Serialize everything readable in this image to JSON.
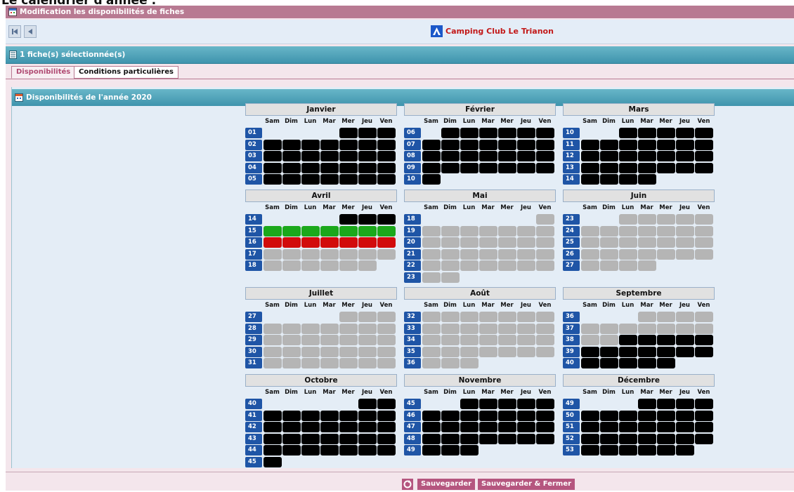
{
  "top_cut_text": "Le calendrier d'année :",
  "window": {
    "title": "Modification les disponibilités de fiches"
  },
  "toolbar": {
    "brand": "Camping Club Le Trianon"
  },
  "selection": {
    "text": "1 fiche(s) sélectionnée(s)"
  },
  "tabs": [
    {
      "label": "Disponibilités"
    },
    {
      "label": "Conditions particulières"
    }
  ],
  "panel": {
    "title": "Disponibilités de l'année 2020"
  },
  "day_names": [
    "Sam",
    "Dim",
    "Lun",
    "Mar",
    "Mer",
    "Jeu",
    "Ven"
  ],
  "legend_colors": {
    "black": "#000000",
    "grey": "#b5b5b5",
    "green": "#1ba81b",
    "red": "#d20b0b",
    "week_badge": "#1f55a6"
  },
  "months": [
    {
      "name": "Janvier",
      "weeks": [
        [
          "01",
          "....bbb"
        ],
        [
          "02",
          "bbbbbbb"
        ],
        [
          "03",
          "bbbbbbb"
        ],
        [
          "04",
          "bbbbbbb"
        ],
        [
          "05",
          "bbbbbbb"
        ]
      ]
    },
    {
      "name": "Février",
      "weeks": [
        [
          "06",
          ".bbbbbb"
        ],
        [
          "07",
          "bbbbbbb"
        ],
        [
          "08",
          "bbbbbbb"
        ],
        [
          "09",
          "bbbbbbb"
        ],
        [
          "10",
          "b......"
        ]
      ]
    },
    {
      "name": "Mars",
      "weeks": [
        [
          "10",
          "..bbbbb"
        ],
        [
          "11",
          "bbbbbbb"
        ],
        [
          "12",
          "bbbbbbb"
        ],
        [
          "13",
          "bbbbbbb"
        ],
        [
          "14",
          "bbbb..."
        ]
      ]
    },
    {
      "name": "Avril",
      "weeks": [
        [
          "14",
          "....bbb"
        ],
        [
          "15",
          "GGGGGGG"
        ],
        [
          "16",
          "RRRRRRR"
        ],
        [
          "17",
          "ggggggg"
        ],
        [
          "18",
          "gggggg."
        ]
      ]
    },
    {
      "name": "Mai",
      "weeks": [
        [
          "18",
          "......g"
        ],
        [
          "19",
          "ggggggg"
        ],
        [
          "20",
          "ggggggg"
        ],
        [
          "21",
          "ggggggg"
        ],
        [
          "22",
          "ggggggg"
        ],
        [
          "23",
          "gg....."
        ]
      ]
    },
    {
      "name": "Juin",
      "weeks": [
        [
          "23",
          "..ggggg"
        ],
        [
          "24",
          "ggggggg"
        ],
        [
          "25",
          "ggggggg"
        ],
        [
          "26",
          "ggggggg"
        ],
        [
          "27",
          "gggg..."
        ]
      ]
    },
    {
      "name": "Juillet",
      "weeks": [
        [
          "27",
          "....ggg"
        ],
        [
          "28",
          "ggggggg"
        ],
        [
          "29",
          "ggggggg"
        ],
        [
          "30",
          "ggggggg"
        ],
        [
          "31",
          "ggggggg"
        ]
      ]
    },
    {
      "name": "Août",
      "weeks": [
        [
          "32",
          "ggggggg"
        ],
        [
          "33",
          "ggggggg"
        ],
        [
          "34",
          "ggggggg"
        ],
        [
          "35",
          "ggggggg"
        ],
        [
          "36",
          "ggg...."
        ]
      ]
    },
    {
      "name": "Septembre",
      "weeks": [
        [
          "36",
          "...gggg"
        ],
        [
          "37",
          "ggggggg"
        ],
        [
          "38",
          "ggbbbbb"
        ],
        [
          "39",
          "bbbbbbb"
        ],
        [
          "40",
          "bbbbb.."
        ]
      ]
    },
    {
      "name": "Octobre",
      "weeks": [
        [
          "40",
          ".....bb"
        ],
        [
          "41",
          "bbbbbbb"
        ],
        [
          "42",
          "bbbbbbb"
        ],
        [
          "43",
          "bbbbbbb"
        ],
        [
          "44",
          "bbbbbbb"
        ],
        [
          "45",
          "b......"
        ]
      ]
    },
    {
      "name": "Novembre",
      "weeks": [
        [
          "45",
          "..bbbbb"
        ],
        [
          "46",
          "bbbbbbb"
        ],
        [
          "47",
          "bbbbbbb"
        ],
        [
          "48",
          "bbbbbbb"
        ],
        [
          "49",
          "bbb...."
        ]
      ]
    },
    {
      "name": "Décembre",
      "weeks": [
        [
          "49",
          "...bbbb"
        ],
        [
          "50",
          "bbbbbbb"
        ],
        [
          "51",
          "bbbbbbb"
        ],
        [
          "52",
          "bbbbbbb"
        ],
        [
          "53",
          "bbbbbb."
        ]
      ]
    }
  ],
  "footer": {
    "save": "Sauvegarder",
    "save_close": "Sauvegarder & Fermer"
  }
}
